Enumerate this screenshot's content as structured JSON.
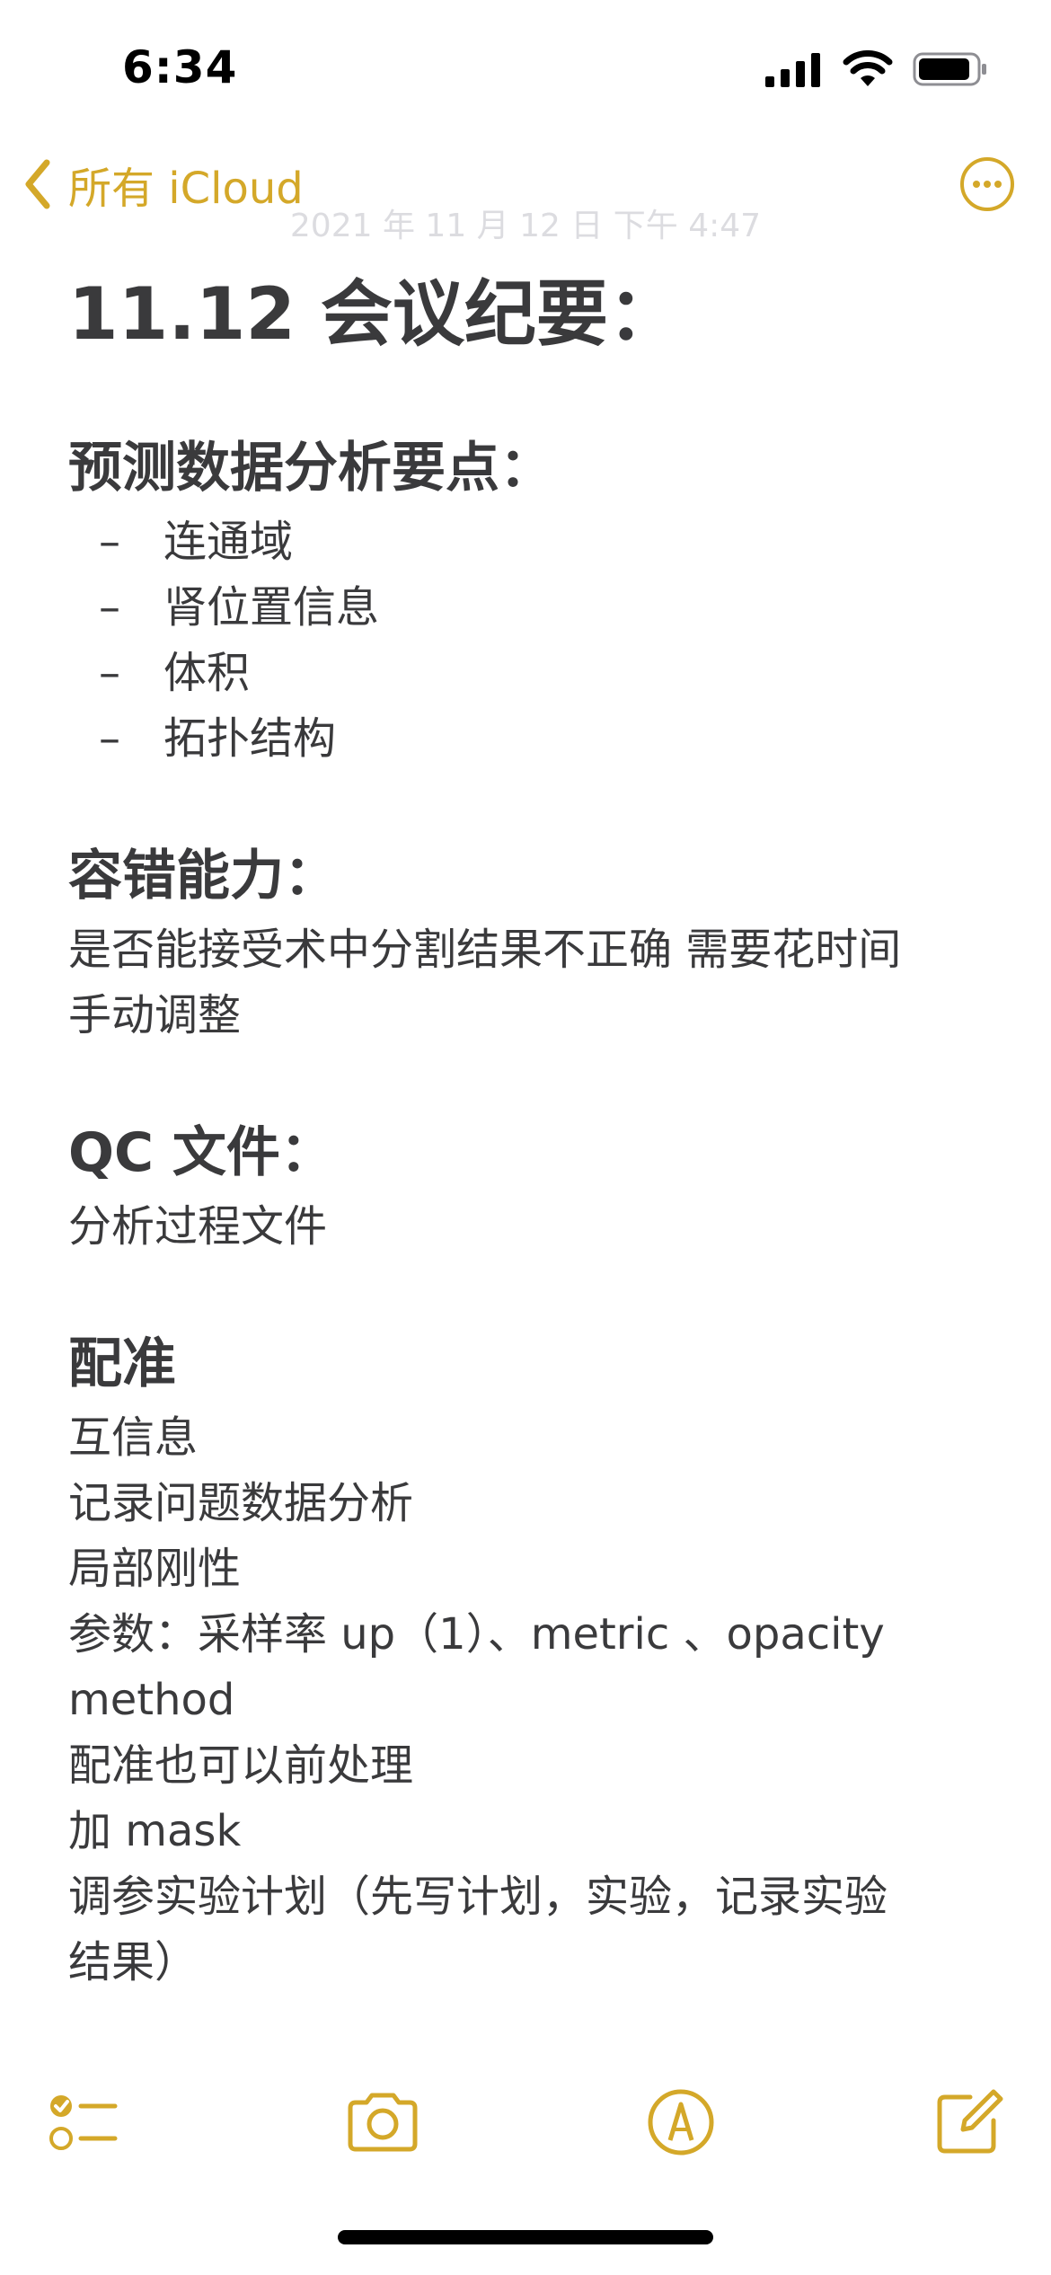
{
  "status_bar": {
    "time": "6:34",
    "icons": [
      "cellular-signal-icon",
      "wifi-icon",
      "battery-icon"
    ]
  },
  "nav": {
    "back_label": "所有 iCloud",
    "date": "2021 年 11 月 12 日 下午 4:47",
    "more_icon": "ellipsis-circle-icon"
  },
  "note": {
    "title": "11.12 会议纪要：",
    "sections": [
      {
        "heading": "预测数据分析要点：",
        "bullets": [
          "连通域",
          "肾位置信息",
          "体积",
          "拓扑结构"
        ]
      },
      {
        "heading": "容错能力：",
        "lines": [
          "是否能接受术中分割结果不正确 需要花时间",
          "手动调整"
        ]
      },
      {
        "heading": "QC 文件：",
        "lines": [
          "分析过程文件"
        ]
      },
      {
        "heading": "配准",
        "lines": [
          "互信息",
          "记录问题数据分析",
          "局部刚性",
          "参数：采样率 up（1）、metric 、opacity",
          "method",
          "配准也可以前处理",
          "加 mask",
          "调参实验计划（先写计划，实验，记录实验",
          "结果）"
        ]
      }
    ]
  },
  "toolbar": {
    "buttons": [
      "checklist-icon",
      "camera-icon",
      "markup-pen-icon",
      "compose-icon"
    ]
  },
  "colors": {
    "accent": "#d4a829",
    "text": "#3a3a3c",
    "date_text": "#dcdce0",
    "background": "#ffffff"
  }
}
